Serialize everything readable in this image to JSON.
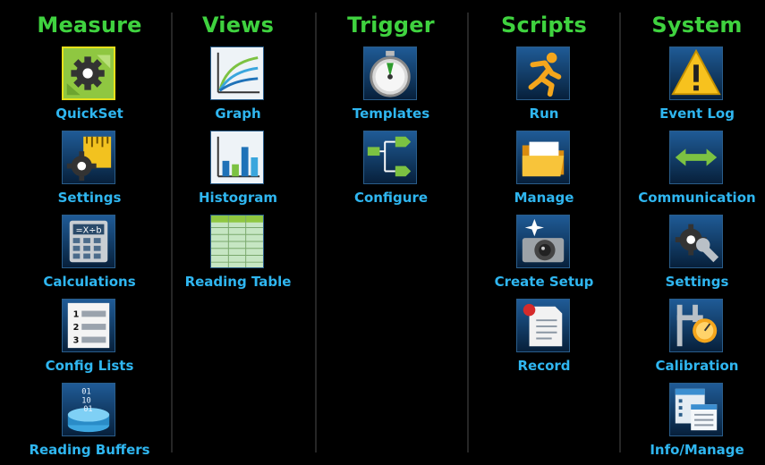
{
  "columns": [
    {
      "title": "Measure",
      "items": [
        {
          "label": "QuickSet",
          "icon": "quickset-gear-icon"
        },
        {
          "label": "Settings",
          "icon": "ruler-gear-icon"
        },
        {
          "label": "Calculations",
          "icon": "calculator-icon"
        },
        {
          "label": "Config Lists",
          "icon": "numbered-list-icon"
        },
        {
          "label": "Reading Buffers",
          "icon": "data-bucket-icon"
        }
      ]
    },
    {
      "title": "Views",
      "items": [
        {
          "label": "Graph",
          "icon": "curve-graph-icon"
        },
        {
          "label": "Histogram",
          "icon": "bar-chart-icon"
        },
        {
          "label": "Reading Table",
          "icon": "table-grid-icon"
        }
      ]
    },
    {
      "title": "Trigger",
      "items": [
        {
          "label": "Templates",
          "icon": "stopwatch-icon"
        },
        {
          "label": "Configure",
          "icon": "flow-arrows-icon"
        }
      ]
    },
    {
      "title": "Scripts",
      "items": [
        {
          "label": "Run",
          "icon": "running-man-icon"
        },
        {
          "label": "Manage",
          "icon": "folder-icon"
        },
        {
          "label": "Create Setup",
          "icon": "camera-icon"
        },
        {
          "label": "Record",
          "icon": "record-page-icon"
        }
      ]
    },
    {
      "title": "System",
      "items": [
        {
          "label": "Event Log",
          "icon": "warning-icon"
        },
        {
          "label": "Communication",
          "icon": "double-arrow-icon"
        },
        {
          "label": "Settings",
          "icon": "wrench-gear-icon"
        },
        {
          "label": "Calibration",
          "icon": "caliper-icon"
        },
        {
          "label": "Info/Manage",
          "icon": "info-windows-icon"
        }
      ]
    }
  ],
  "colors": {
    "background": "#000000",
    "heading": "#3fd23f",
    "label": "#2fb6f0",
    "selection_border": "#e7e01b"
  },
  "selected_item": "QuickSet"
}
